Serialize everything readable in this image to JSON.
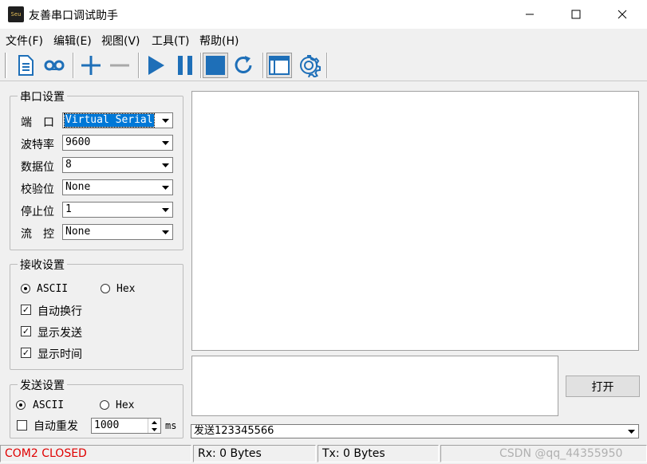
{
  "window": {
    "icon_text": "Seu",
    "title": "友善串口调试助手",
    "minimize": "—",
    "maximize": "☐",
    "close": "✕"
  },
  "menu": [
    "文件(F)",
    "编辑(E)",
    "视图(V)",
    "工具(T)",
    "帮助(H)"
  ],
  "toolbar": {
    "icons": [
      "new-file-icon",
      "cassette-icon",
      "plus-icon",
      "minus-icon",
      "play-icon",
      "pause-icon",
      "stop-icon",
      "refresh-icon",
      "window-icon",
      "gear-icon"
    ],
    "accent_color": "#1e6fb8"
  },
  "serial_settings": {
    "title": "串口设置",
    "fields": [
      {
        "label": "端　口",
        "value": "Virtual Serial"
      },
      {
        "label": "波特率",
        "value": "9600"
      },
      {
        "label": "数据位",
        "value": "8"
      },
      {
        "label": "校验位",
        "value": "None"
      },
      {
        "label": "停止位",
        "value": "1"
      },
      {
        "label": "流　控",
        "value": "None"
      }
    ]
  },
  "receive_settings": {
    "title": "接收设置",
    "mode_ascii": "ASCII",
    "mode_hex": "Hex",
    "selected_mode": "ASCII",
    "auto_newline": "自动换行",
    "show_sent": "显示发送",
    "show_time": "显示时间",
    "auto_newline_checked": true,
    "show_sent_checked": true,
    "show_time_checked": true
  },
  "send_settings": {
    "title": "发送设置",
    "mode_ascii": "ASCII",
    "mode_hex": "Hex",
    "selected_mode": "ASCII",
    "auto_resend": "自动重发",
    "auto_resend_checked": false,
    "interval": "1000",
    "interval_unit": "ms"
  },
  "open_button": "打开",
  "send_input": "发送123345566",
  "status": {
    "port": "COM2 CLOSED",
    "port_color": "#e00000",
    "rx": "Rx: 0 Bytes",
    "tx": "Tx: 0 Bytes"
  },
  "watermark": "CSDN @qq_44355950"
}
